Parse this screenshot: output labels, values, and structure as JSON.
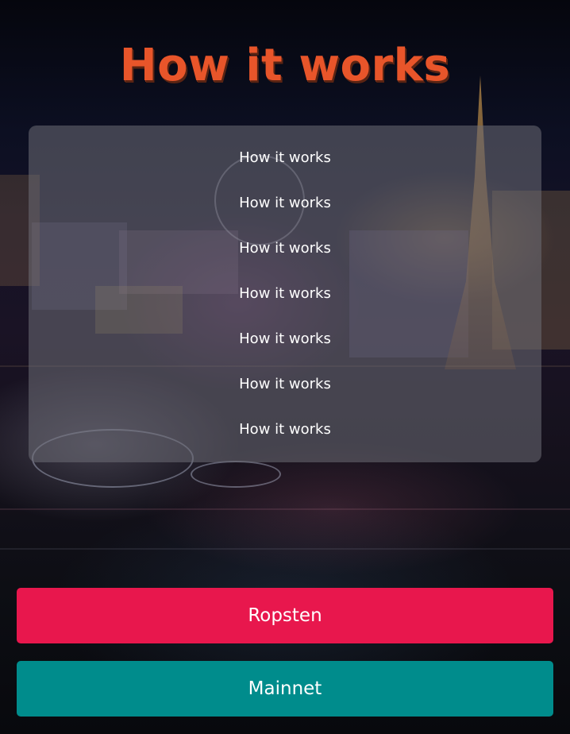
{
  "page": {
    "title": "How it works"
  },
  "panel": {
    "steps": [
      "How it works",
      "How it works",
      "How it works",
      "How it works",
      "How it works",
      "How it works",
      "How it works"
    ]
  },
  "buttons": {
    "ropsten_label": "Ropsten",
    "mainnet_label": "Mainnet"
  },
  "colors": {
    "title": "#e8552a",
    "ropsten_button": "#e8174d",
    "mainnet_button": "#008c8c",
    "panel": "#6e6e76"
  }
}
